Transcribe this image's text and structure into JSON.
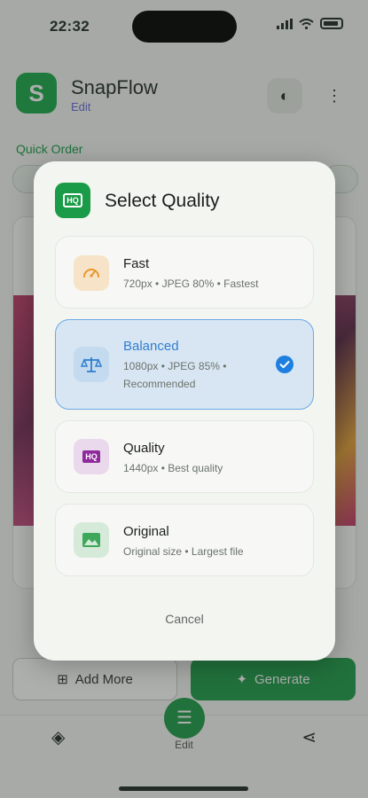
{
  "status": {
    "time": "22:32"
  },
  "app": {
    "name": "SnapFlow",
    "subtitle": "Edit",
    "logo_letter": "S"
  },
  "quick_order": {
    "label": "Quick Order"
  },
  "bottom": {
    "add_more": "Add More",
    "generate": "Generate"
  },
  "tabs": {
    "edit": "Edit"
  },
  "dialog": {
    "title": "Select Quality",
    "options": [
      {
        "name": "Fast",
        "desc": "720px • JPEG 80% • Fastest",
        "icon": "speedometer-icon",
        "selected": false
      },
      {
        "name": "Balanced",
        "desc": "1080px • JPEG 85% • Recommended",
        "icon": "balance-scale-icon",
        "selected": true
      },
      {
        "name": "Quality",
        "desc": "1440px • Best quality",
        "icon": "hq-icon",
        "selected": false
      },
      {
        "name": "Original",
        "desc": "Original size • Largest file",
        "icon": "image-icon",
        "selected": false
      }
    ],
    "cancel": "Cancel"
  },
  "colors": {
    "accent_green": "#1a9b47",
    "selected_blue": "#1e7fe0"
  }
}
